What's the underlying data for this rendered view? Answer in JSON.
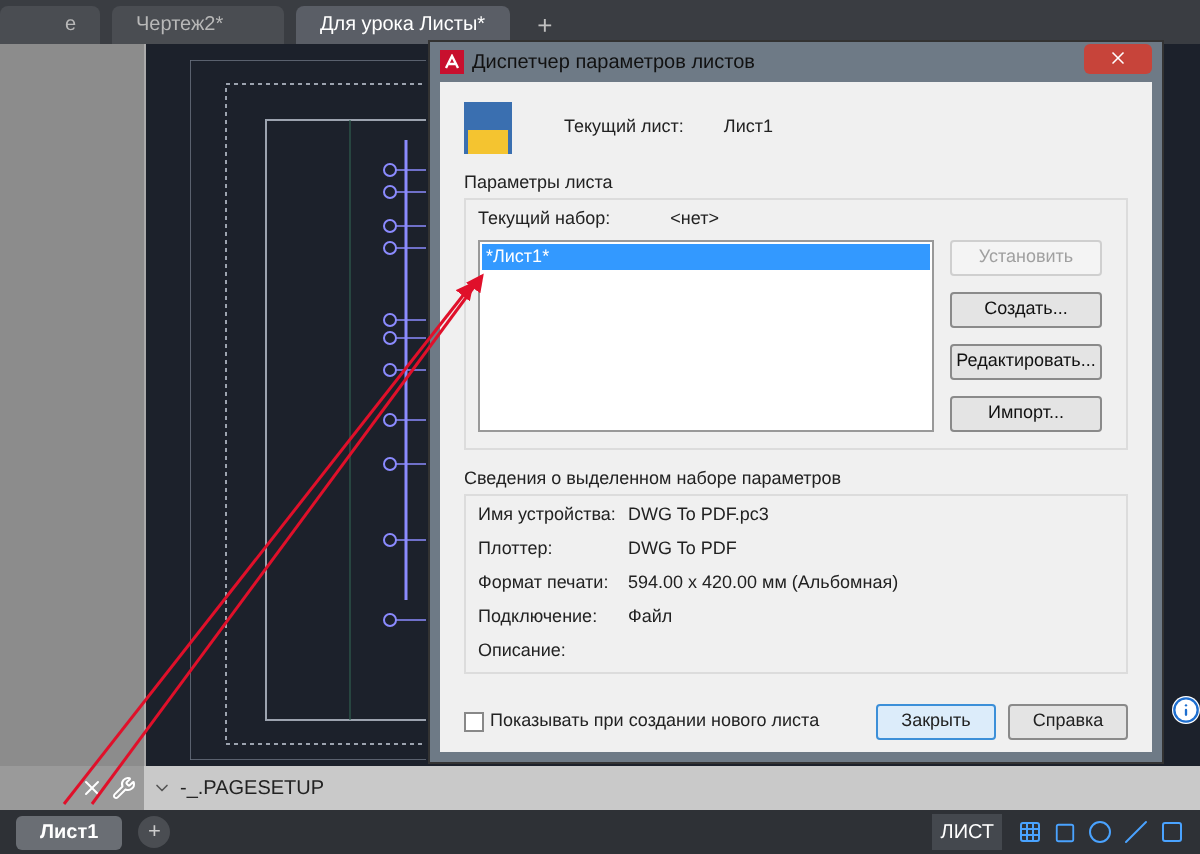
{
  "document_tabs": [
    {
      "label": "е",
      "selected": false
    },
    {
      "label": "Чертеж2*",
      "selected": false
    },
    {
      "label": "Для урока Листы*",
      "selected": true
    }
  ],
  "new_tab_button": "+",
  "dialog": {
    "title": "Диспетчер параметров листов",
    "current_sheet_label": "Текущий лист:",
    "current_sheet_value": "Лист1",
    "page_setups": {
      "title": "Параметры листа",
      "current_set_label": "Текущий набор:",
      "current_set_value": "<нет>",
      "items": [
        {
          "label": "*Лист1*",
          "selected": true
        }
      ],
      "buttons": [
        {
          "label": "Установить",
          "disabled": true
        },
        {
          "label": "Создать...",
          "disabled": false
        },
        {
          "label": "Редактировать...",
          "disabled": false
        },
        {
          "label": "Импорт...",
          "disabled": false
        }
      ]
    },
    "details": {
      "title": "Сведения о выделенном наборе параметров",
      "rows": [
        {
          "label": "Имя устройства:",
          "value": "DWG To PDF.pc3"
        },
        {
          "label": "Плоттер:",
          "value": "DWG To PDF"
        },
        {
          "label": "Формат печати:",
          "value": "594.00 x 420.00 мм (Альбомная)"
        },
        {
          "label": "Подключение:",
          "value": "Файл"
        },
        {
          "label": "Описание:"
        }
      ]
    },
    "show_on_create": {
      "label": "Показывать при создании нового листа",
      "checked": false
    },
    "buttons": [
      {
        "label": "Закрыть",
        "default": true
      },
      {
        "label": "Справка",
        "default": false
      }
    ]
  },
  "command_line": {
    "value": "-_.PAGESETUP"
  },
  "layout_tabs": [
    {
      "label": "Лист1",
      "selected": true
    }
  ],
  "add_layout_button": "+",
  "status_bar": {
    "mode": "ЛИСТ"
  }
}
